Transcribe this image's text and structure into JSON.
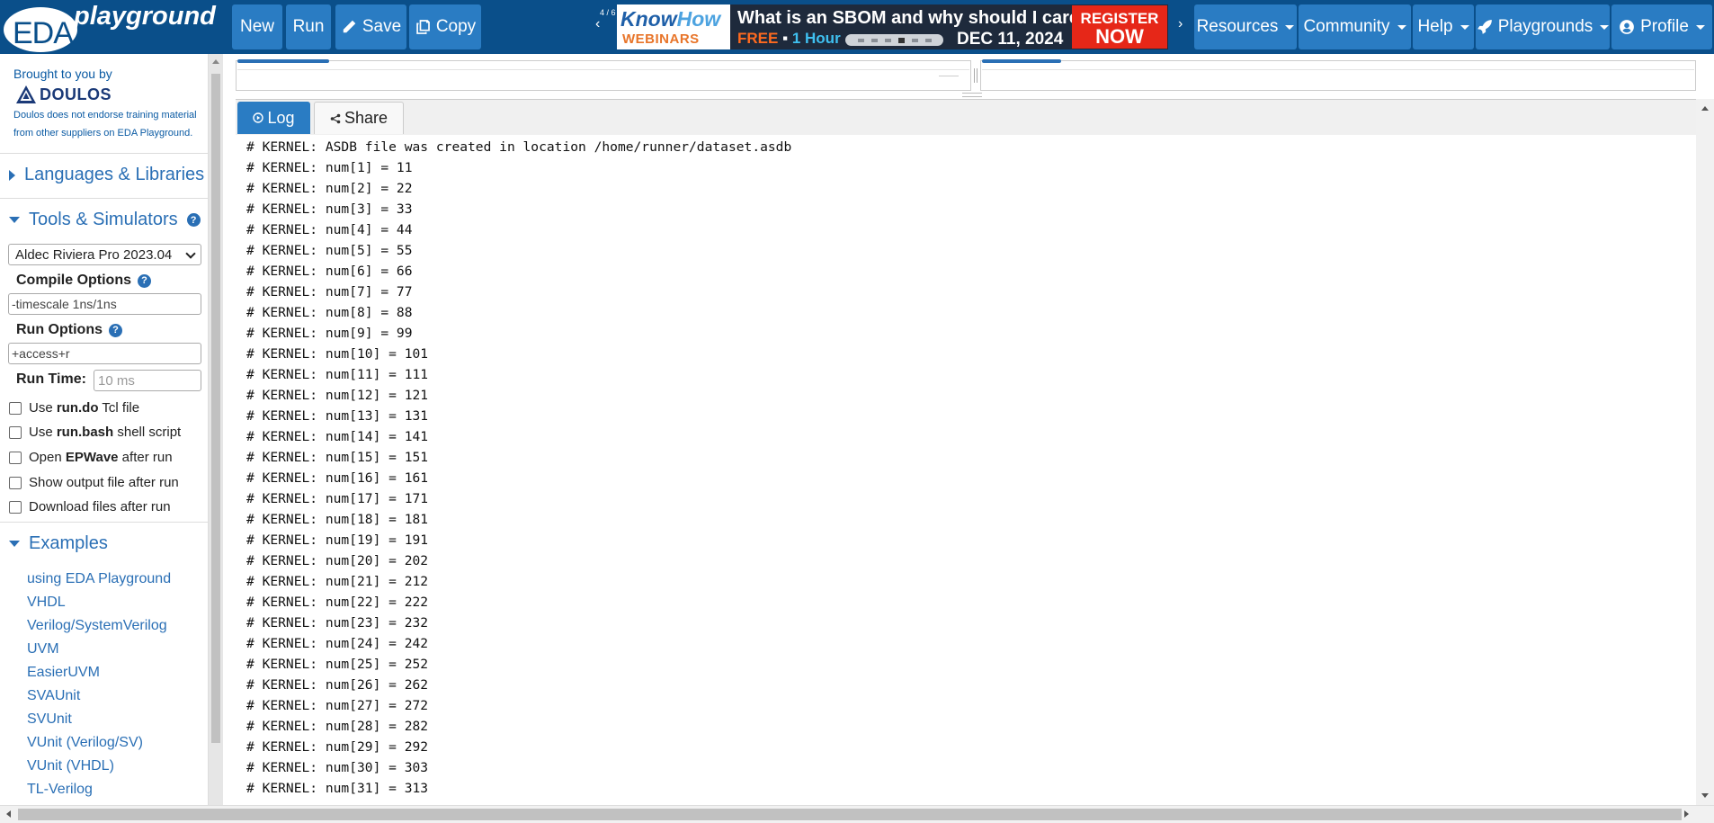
{
  "navbar": {
    "logo_eda": "EDA",
    "logo_playground": "playground",
    "buttons": {
      "new": "New",
      "run": "Run",
      "save": "Save",
      "copy": "Copy"
    },
    "menus": {
      "resources": "Resources",
      "community": "Community",
      "help": "Help",
      "playgrounds": "Playgrounds",
      "profile": "Profile"
    }
  },
  "ad": {
    "counter": "4 / 6",
    "brand_know": "Know",
    "brand_how": "How",
    "brand_webinars": "WEBINARS",
    "title": "What is an SBOM and why should I care?",
    "free": "FREE",
    "separator": "▪",
    "duration": "1 Hour",
    "date": "DEC 11, 2024",
    "register_1": "REGISTER",
    "register_2": "NOW"
  },
  "sidebar": {
    "brought_by": "Brought to you by",
    "doulos": "DOULOS",
    "note_1": "Doulos does not endorse training material",
    "note_2": "from other suppliers on EDA Playground.",
    "sections": {
      "languages": "Languages & Libraries",
      "tools": "Tools & Simulators",
      "examples": "Examples"
    },
    "simulator": "Aldec Riviera Pro 2023.04",
    "compile_options_label": "Compile Options",
    "compile_options_value": "-timescale 1ns/1ns",
    "run_options_label": "Run Options",
    "run_options_value": "+access+r",
    "run_time_label": "Run Time:",
    "run_time_placeholder": "10 ms",
    "checkboxes": [
      {
        "pre": "Use ",
        "bold": "run.do",
        "post": " Tcl file",
        "checked": false
      },
      {
        "pre": "Use ",
        "bold": "run.bash",
        "post": " shell script",
        "checked": false
      },
      {
        "pre": "Open ",
        "bold": "EPWave",
        "post": " after run",
        "checked": false
      },
      {
        "pre": "Show output file after run",
        "bold": "",
        "post": "",
        "checked": false
      },
      {
        "pre": "Download files after run",
        "bold": "",
        "post": "",
        "checked": false
      }
    ],
    "examples": [
      "using EDA Playground",
      "VHDL",
      "Verilog/SystemVerilog",
      "UVM",
      "EasierUVM",
      "SVAUnit",
      "SVUnit",
      "VUnit (Verilog/SV)",
      "VUnit (VHDL)",
      "TL-Verilog"
    ]
  },
  "tabs": {
    "log": "Log",
    "share": "Share"
  },
  "log_lines": [
    "# KERNEL: ASDB file was created in location /home/runner/dataset.asdb",
    "# KERNEL: num[1] = 11",
    "# KERNEL: num[2] = 22",
    "# KERNEL: num[3] = 33",
    "# KERNEL: num[4] = 44",
    "# KERNEL: num[5] = 55",
    "# KERNEL: num[6] = 66",
    "# KERNEL: num[7] = 77",
    "# KERNEL: num[8] = 88",
    "# KERNEL: num[9] = 99",
    "# KERNEL: num[10] = 101",
    "# KERNEL: num[11] = 111",
    "# KERNEL: num[12] = 121",
    "# KERNEL: num[13] = 131",
    "# KERNEL: num[14] = 141",
    "# KERNEL: num[15] = 151",
    "# KERNEL: num[16] = 161",
    "# KERNEL: num[17] = 171",
    "# KERNEL: num[18] = 181",
    "# KERNEL: num[19] = 191",
    "# KERNEL: num[20] = 202",
    "# KERNEL: num[21] = 212",
    "# KERNEL: num[22] = 222",
    "# KERNEL: num[23] = 232",
    "# KERNEL: num[24] = 242",
    "# KERNEL: num[25] = 252",
    "# KERNEL: num[26] = 262",
    "# KERNEL: num[27] = 272",
    "# KERNEL: num[28] = 282",
    "# KERNEL: num[29] = 292",
    "# KERNEL: num[30] = 303",
    "# KERNEL: num[31] = 313"
  ],
  "icons": {
    "save": "pencil-icon",
    "copy": "copy-icon",
    "playgrounds": "rocket-icon",
    "profile": "user-circle-icon",
    "log": "play-circle-icon",
    "share": "share-icon",
    "help": "question-circle-icon"
  },
  "colors": {
    "navbar": "#0a4f8a",
    "button": "#2a7cc3",
    "link": "#2a6fb5",
    "register": "#e62718",
    "webinars": "#e8752a"
  }
}
